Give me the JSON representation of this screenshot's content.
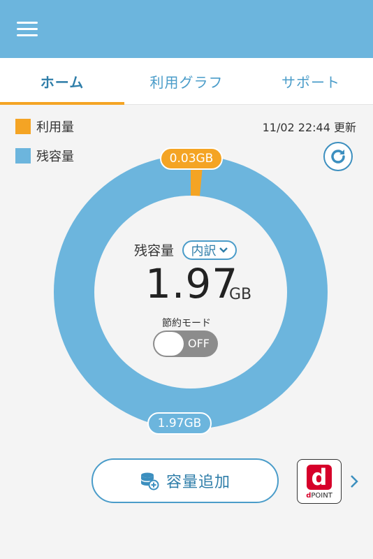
{
  "tabs": [
    {
      "label": "ホーム"
    },
    {
      "label": "利用グラフ"
    },
    {
      "label": "サポート"
    }
  ],
  "legend": {
    "used_label": "利用量",
    "remaining_label": "残容量"
  },
  "updated_text": "11/02 22:44 更新",
  "colors": {
    "header": "#6cb5dd",
    "used": "#f4a424",
    "remaining": "#6cb5dd",
    "accent": "#2f7ea9"
  },
  "usage": {
    "used_label": "0.03GB",
    "remaining_label": "1.97GB",
    "used_gb": 0.03,
    "remaining_gb": 1.97
  },
  "center": {
    "label": "残容量",
    "breakdown_label": "内訳",
    "value": "1.97",
    "unit": "GB"
  },
  "saving_mode": {
    "label": "節約モード",
    "state": "OFF"
  },
  "add_capacity_label": "容量追加",
  "dpoint": {
    "logo_letter": "d",
    "text": "POINT"
  }
}
